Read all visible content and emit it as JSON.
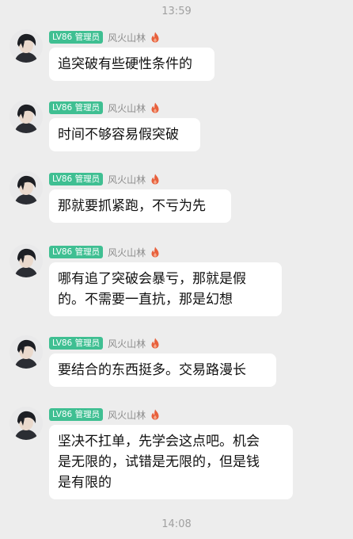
{
  "chat": {
    "timestamp_top": "13:59",
    "timestamp_bottom": "14:08",
    "messages": [
      {
        "badge": "LV86 管理员",
        "username": "风火山林",
        "avatar_icon": "user-avatar",
        "title_icon": "flame-icon",
        "text": "追突破有些硬性条件的"
      },
      {
        "badge": "LV86 管理员",
        "username": "风火山林",
        "avatar_icon": "user-avatar",
        "title_icon": "flame-icon",
        "text": "时间不够容易假突破"
      },
      {
        "badge": "LV86 管理员",
        "username": "风火山林",
        "avatar_icon": "user-avatar",
        "title_icon": "flame-icon",
        "text": "那就要抓紧跑，不亏为先"
      },
      {
        "badge": "LV86 管理员",
        "username": "风火山林",
        "avatar_icon": "user-avatar",
        "title_icon": "flame-icon",
        "lines": [
          "哪有追了突破会暴亏，那就是假",
          "的。不需要一直抗，那是幻想"
        ]
      },
      {
        "badge": "LV86 管理员",
        "username": "风火山林",
        "avatar_icon": "user-avatar",
        "title_icon": "flame-icon",
        "text": "要结合的东西挺多。交易路漫长"
      },
      {
        "badge": "LV86 管理员",
        "username": "风火山林",
        "avatar_icon": "user-avatar",
        "title_icon": "flame-icon",
        "lines": [
          "坚决不扛单，先学会这点吧。机会",
          "是无限的，试错是无限的，但是钱",
          "是有限的"
        ]
      }
    ]
  },
  "colors": {
    "background": "#ededed",
    "bubble": "#ffffff",
    "badge": "#3fbf92",
    "flame": "#e8603c"
  }
}
